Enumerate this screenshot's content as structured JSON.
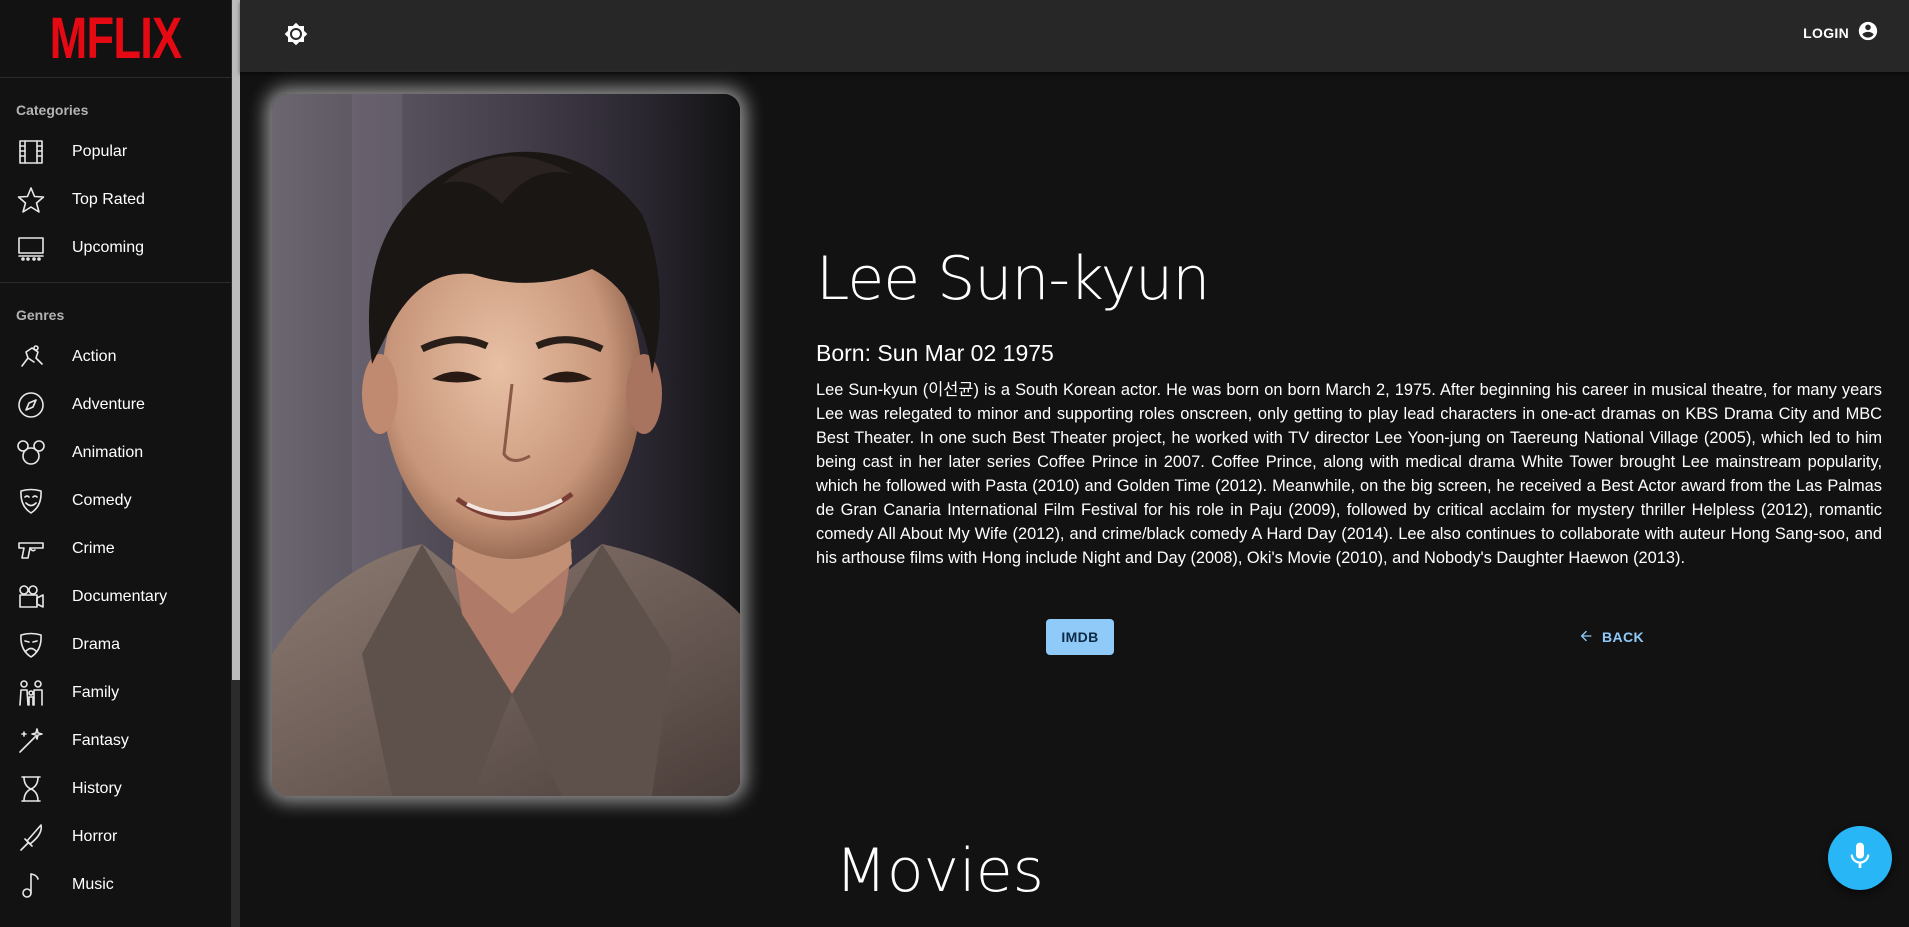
{
  "app": {
    "logo_text": "MFLIX",
    "brand_color": "#e50914",
    "accent_color": "#90caf9"
  },
  "sidebar": {
    "categories_title": "Categories",
    "categories": [
      {
        "label": "Popular",
        "icon": "film-icon"
      },
      {
        "label": "Top Rated",
        "icon": "star-icon"
      },
      {
        "label": "Upcoming",
        "icon": "theater-icon"
      }
    ],
    "genres_title": "Genres",
    "genres": [
      {
        "label": "Action",
        "icon": "action-icon"
      },
      {
        "label": "Adventure",
        "icon": "compass-icon"
      },
      {
        "label": "Animation",
        "icon": "mouse-ears-icon"
      },
      {
        "label": "Comedy",
        "icon": "happy-mask-icon"
      },
      {
        "label": "Crime",
        "icon": "gun-icon"
      },
      {
        "label": "Documentary",
        "icon": "video-camera-icon"
      },
      {
        "label": "Drama",
        "icon": "sad-mask-icon"
      },
      {
        "label": "Family",
        "icon": "family-icon"
      },
      {
        "label": "Fantasy",
        "icon": "magic-wand-icon"
      },
      {
        "label": "History",
        "icon": "hourglass-icon"
      },
      {
        "label": "Horror",
        "icon": "knife-icon"
      },
      {
        "label": "Music",
        "icon": "music-note-icon"
      }
    ]
  },
  "topbar": {
    "theme_icon": "brightness-icon",
    "login_label": "LOGIN",
    "login_icon": "account-circle-icon"
  },
  "actor": {
    "name": "Lee Sun-kyun",
    "born": "Born: Sun Mar 02 1975",
    "bio": "Lee Sun-kyun (이선균) is a South Korean actor. He was born on born March 2, 1975. After beginning his career in musical theatre, for many years Lee was relegated to minor and supporting roles onscreen, only getting to play lead characters in one-act dramas on KBS Drama City and MBC Best Theater. In one such Best Theater project, he worked with TV director Lee Yoon-jung on Taereung National Village (2005), which led to him being cast in her later series Coffee Prince in 2007. Coffee Prince, along with medical drama White Tower brought Lee mainstream popularity, which he followed with Pasta (2010) and Golden Time (2012). Meanwhile, on the big screen, he received a Best Actor award from the Las Palmas de Gran Canaria International Film Festival for his role in Paju (2009), followed by critical acclaim for mystery thriller Helpless (2012), romantic comedy All About My Wife (2012), and crime/black comedy A Hard Day (2014). Lee also continues to collaborate with auteur Hong Sang-soo, and his arthouse films with Hong include Night and Day (2008), Oki's Movie (2010), and Nobody's Daughter Haewon (2013)."
  },
  "actions": {
    "imdb_label": "IMDB",
    "back_label": "BACK",
    "back_icon": "arrow-back-icon"
  },
  "movies_section": {
    "title": "Movies"
  },
  "fab": {
    "icon": "microphone-icon",
    "color": "#29b6f6"
  }
}
